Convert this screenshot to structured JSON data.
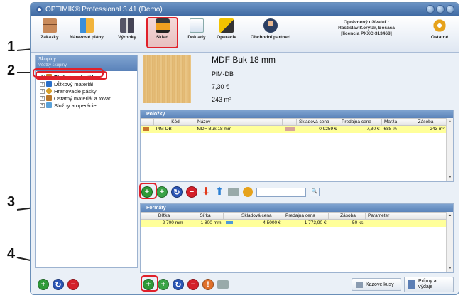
{
  "callouts": [
    "1",
    "2",
    "3",
    "4"
  ],
  "window": {
    "title": "OPTIMIK® Professional 3.41  (Demo)"
  },
  "toolbar": {
    "items": [
      "Zákazky",
      "Nárezové plány",
      "Výrobky",
      "Sklad",
      "Doklady",
      "Operácie",
      "Obchodní partneri",
      "Ostatné"
    ],
    "user_label": "Oprávnený užívateľ :",
    "user_name": "Rastislav Korytár, Bošáca",
    "license": "[licencia PXXC-313468]"
  },
  "groups": {
    "header": "Skupiny",
    "all_groups": "Všetky skupiny",
    "items": [
      "Plošný materiál",
      "Dĺžkový materiál",
      "Hranovacie pásky",
      "Ostatný materiál a tovar",
      "Služby a operácie"
    ]
  },
  "detail": {
    "name": "MDF Buk 18 mm",
    "code": "PlM-DB",
    "price": "7,30 €",
    "stock": "243 m²"
  },
  "polozky": {
    "header": "Položky",
    "columns": [
      "Kód",
      "Názov",
      "Skladová cena",
      "Predajná cena",
      "Marža",
      "Zásoba"
    ],
    "rows": [
      {
        "kod": "PlM-DB",
        "nazov": "MDF Buk 18 mm",
        "skladova": "0,9259 €",
        "predajna": "7,30 €",
        "marza": "688 %",
        "zasoba": "243 m²"
      }
    ]
  },
  "formaty": {
    "header": "Formáty",
    "columns": [
      "Dĺžka",
      "Šírka",
      "Skladová cena",
      "Predajná cena",
      "Zásoba",
      "Parameter"
    ],
    "rows": [
      {
        "dlzka": "2 700 mm",
        "sirka": "1 800 mm",
        "skladova": "4,5000 €",
        "predajna": "1 773,90 €",
        "zasoba": "50 ks",
        "parameter": ""
      }
    ]
  },
  "footer": {
    "kazove": "Kazové kusy",
    "prijmy": "Príjmy a",
    "vydaje": "výdaje"
  }
}
